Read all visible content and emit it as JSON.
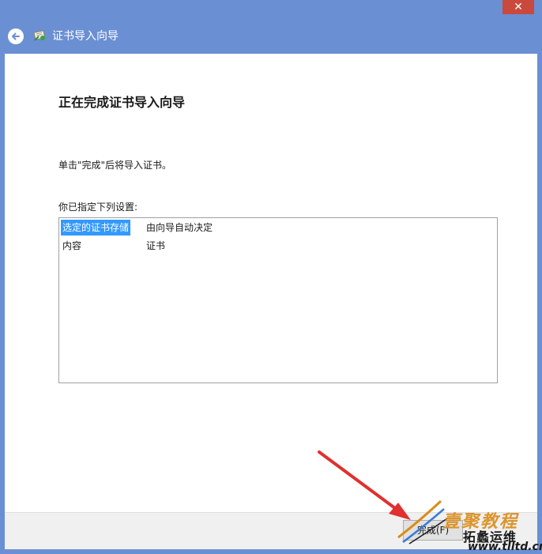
{
  "window": {
    "title": "证书导入向导",
    "close_label": "✕"
  },
  "page": {
    "heading": "正在完成证书导入向导",
    "instruction": "单击\"完成\"后将导入证书。",
    "settings_label": "你已指定下列设置:",
    "settings": [
      {
        "key": "选定的证书存储",
        "value": "由向导自动决定",
        "selected": true
      },
      {
        "key": "内容",
        "value": "证书",
        "selected": false
      }
    ]
  },
  "footer": {
    "finish_label": "完成(F)"
  },
  "watermark": {
    "line1": "壹聚教程",
    "line2": "拓蠡运维",
    "line3": "www.tlltd.cn"
  },
  "colors": {
    "title_bar": "#6a8fd3",
    "close_button": "#c94a3c",
    "selection": "#3399ff",
    "arrow": "#e03030"
  },
  "icons": {
    "back": "back-arrow-icon",
    "wizard": "certificate-wizard-icon",
    "close": "close-icon"
  }
}
